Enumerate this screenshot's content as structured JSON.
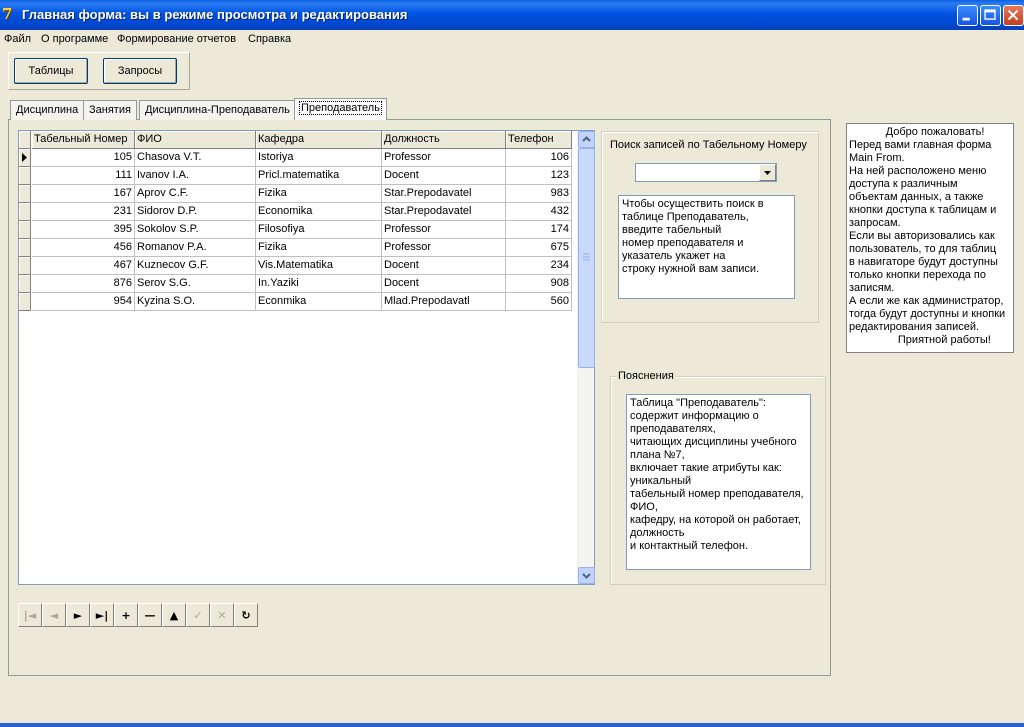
{
  "window": {
    "title": "Главная форма: вы в режиме просмотра и редактирования",
    "app_icon": "7"
  },
  "menu": [
    "Файл",
    "О программе",
    "Формирование отчетов",
    "Справка"
  ],
  "toolbar": {
    "tables": "Таблицы",
    "queries": "Запросы"
  },
  "tabs": [
    "Дисциплина",
    "Занятия",
    "Дисциплина-Преподаватель",
    "Преподаватель"
  ],
  "active_tab": 3,
  "grid": {
    "columns": [
      "Табельный Номер",
      "ФИО",
      "Кафедра",
      "Должность",
      "Телефон"
    ],
    "rows": [
      [
        "105",
        "Chasova V.T.",
        "Istoriya",
        "Professor",
        "106"
      ],
      [
        "111",
        "Ivanov I.A.",
        "Pricl.matematika",
        "Docent",
        "123"
      ],
      [
        "167",
        "Aprov C.F.",
        "Fizika",
        "Star.Prepodavatel",
        "983"
      ],
      [
        "231",
        "Sidorov D.P.",
        "Economika",
        "Star.Prepodavatel",
        "432"
      ],
      [
        "395",
        "Sokolov S.P.",
        "Filosofiya",
        "Professor",
        "174"
      ],
      [
        "456",
        "Romanov P.A.",
        "Fizika",
        "Professor",
        "675"
      ],
      [
        "467",
        "Kuznecov G.F.",
        "Vis.Matematika",
        "Docent",
        "234"
      ],
      [
        "876",
        "Serov S.G.",
        "In.Yaziki",
        "Docent",
        "908"
      ],
      [
        "954",
        "Kyzina S.O.",
        "Econmika",
        "Mlad.Prepodavatl",
        "560"
      ]
    ]
  },
  "navigator": {
    "buttons": [
      {
        "name": "first-record-icon",
        "glyph": "|◄",
        "enabled": false
      },
      {
        "name": "prior-record-icon",
        "glyph": "◄",
        "enabled": false
      },
      {
        "name": "next-record-icon",
        "glyph": "►",
        "enabled": true
      },
      {
        "name": "last-record-icon",
        "glyph": "►|",
        "enabled": true
      },
      {
        "name": "insert-record-icon",
        "glyph": "+",
        "enabled": true
      },
      {
        "name": "delete-record-icon",
        "glyph": "—",
        "enabled": true
      },
      {
        "name": "edit-record-icon",
        "glyph": "▲",
        "enabled": true
      },
      {
        "name": "post-record-icon",
        "glyph": "✓",
        "enabled": false
      },
      {
        "name": "cancel-edit-icon",
        "glyph": "✕",
        "enabled": false
      },
      {
        "name": "refresh-icon",
        "glyph": "↻",
        "enabled": true
      }
    ]
  },
  "search": {
    "caption": "Поиск записей по Табельному Номеру",
    "value": "",
    "hint": "Чтобы осуществить поиск в\nтаблице Преподаватель,\nвведите табельный\nномер преподавателя и\nуказатель укажет на\nстроку нужной вам записи."
  },
  "explanations": {
    "caption": "Пояснения",
    "text": "Таблица \"Преподаватель\":\nсодержит информацию о\nпреподавателях,\nчитающих дисциплины учебного\nплана №7,\nвключает такие атрибуты как:\nуникальный\nтабельный номер преподавателя,\nФИО,\nкафедру, на которой он работает,\nдолжность\nи контактный телефон."
  },
  "welcome": {
    "text": "            Добро пожаловать!\nПеред вами главная форма\nMain From.\nНа ней расположено меню\nдоступа к различным\nобъектам данных, а также\nкнопки доступа к таблицам и\nзапросам.\nЕсли вы авторизовались как\nпользователь, то для таблиц\nв навигаторе будут доступны\nтолько кнопки перехода по\nзаписям.\nА если же как администратор,\nтогда будут доступны и кнопки\nредактирования записей.\n                Приятной работы!"
  },
  "colors": {
    "titlebar": "#0053e1",
    "face": "#ece9d8",
    "grid_border": "#7f9db9"
  }
}
